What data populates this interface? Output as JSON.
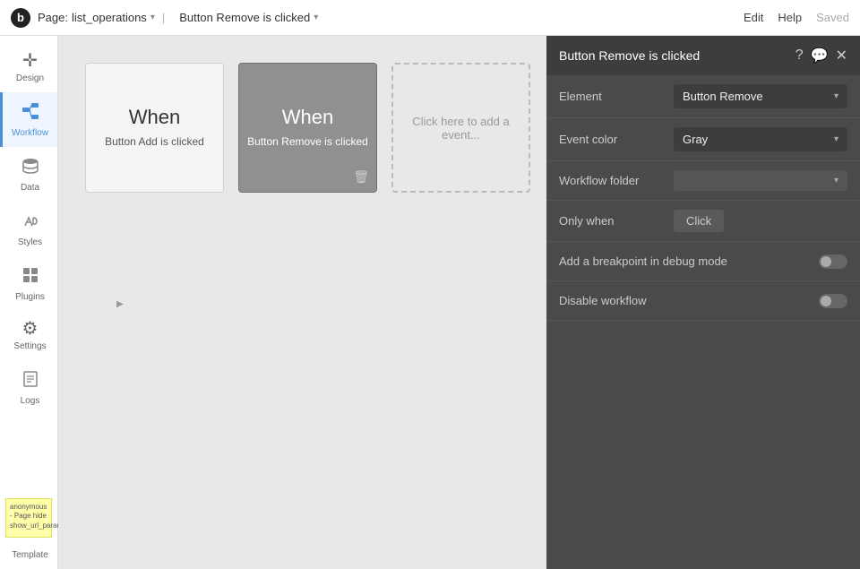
{
  "topbar": {
    "logo": "b",
    "page_label": "Page:",
    "page_name": "list_operations",
    "event_name": "Button Remove is clicked",
    "actions": [
      "Edit",
      "Help"
    ],
    "saved_label": "Saved"
  },
  "sidebar": {
    "items": [
      {
        "id": "design",
        "label": "Design",
        "icon": "✛"
      },
      {
        "id": "workflow",
        "label": "Workflow",
        "icon": "⬡",
        "active": true
      },
      {
        "id": "data",
        "label": "Data",
        "icon": "🗄"
      },
      {
        "id": "styles",
        "label": "Styles",
        "icon": "✏"
      },
      {
        "id": "plugins",
        "label": "Plugins",
        "icon": "⊞"
      },
      {
        "id": "settings",
        "label": "Settings",
        "icon": "⚙"
      },
      {
        "id": "logs",
        "label": "Logs",
        "icon": "📋"
      }
    ],
    "template_label": "Template",
    "sticky_note": "anonymous - Page hide show_url_param"
  },
  "canvas": {
    "cards": [
      {
        "id": "when-add",
        "type": "light",
        "title": "When",
        "subtitle": "Button Add is clicked",
        "selected": false
      },
      {
        "id": "when-remove",
        "type": "selected",
        "title": "When",
        "subtitle": "Button Remove is clicked",
        "selected": true,
        "has_delete": true
      }
    ],
    "add_event_label": "Click here to add a event..."
  },
  "panel": {
    "title": "Button Remove is clicked",
    "icons": [
      "?",
      "💬",
      "✕"
    ],
    "rows": [
      {
        "id": "element",
        "label": "Element",
        "value": "Button Remove",
        "type": "select"
      },
      {
        "id": "event_color",
        "label": "Event color",
        "value": "Gray",
        "type": "select"
      },
      {
        "id": "workflow_folder",
        "label": "Workflow folder",
        "value": "",
        "type": "select"
      }
    ],
    "only_when": {
      "label": "Only when",
      "button_label": "Click"
    },
    "toggles": [
      {
        "id": "breakpoint",
        "label": "Add a breakpoint in debug mode"
      },
      {
        "id": "disable",
        "label": "Disable workflow"
      }
    ]
  }
}
